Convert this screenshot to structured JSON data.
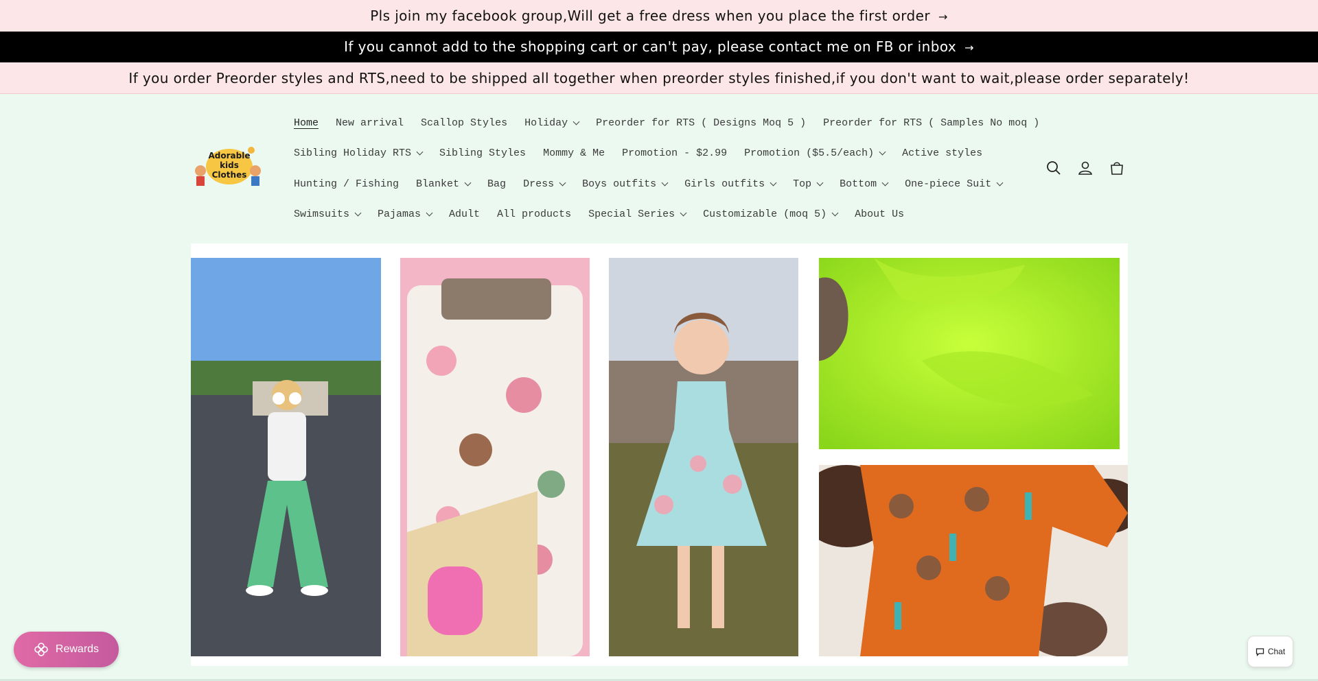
{
  "announcements": [
    {
      "text": "Pls join my facebook group,Will get a free dress when you place the first order",
      "arrow": "→"
    },
    {
      "text": "If you cannot add to the shopping cart or can't pay, please contact me on FB or inbox",
      "arrow": "→"
    },
    {
      "text": "If you order Preorder styles and RTS,need to be shipped all together when preorder styles finished,if you don't want to wait,please order separately!"
    }
  ],
  "logo": {
    "line1": "Adorable",
    "line2": "kids",
    "line3": "Clothes"
  },
  "nav": {
    "rows": [
      [
        {
          "label": "Home",
          "active": true
        },
        {
          "label": "New arrival"
        },
        {
          "label": "Scallop Styles"
        },
        {
          "label": "Holiday",
          "dropdown": true
        },
        {
          "label": "Preorder for RTS ( Designs Moq 5 )"
        },
        {
          "label": "Preorder for RTS ( Samples No moq )"
        }
      ],
      [
        {
          "label": "Sibling Holiday RTS",
          "dropdown": true
        },
        {
          "label": "Sibling Styles"
        },
        {
          "label": "Mommy & Me"
        },
        {
          "label": "Promotion - $2.99"
        },
        {
          "label": "Promotion ($5.5/each)",
          "dropdown": true
        },
        {
          "label": "Active styles"
        }
      ],
      [
        {
          "label": "Hunting / Fishing"
        },
        {
          "label": "Blanket",
          "dropdown": true
        },
        {
          "label": "Bag"
        },
        {
          "label": "Dress",
          "dropdown": true
        },
        {
          "label": "Boys outfits",
          "dropdown": true
        },
        {
          "label": "Girls outfits",
          "dropdown": true
        },
        {
          "label": "Top",
          "dropdown": true
        },
        {
          "label": "Bottom",
          "dropdown": true
        },
        {
          "label": "One-piece Suit",
          "dropdown": true
        }
      ],
      [
        {
          "label": "Swimsuits",
          "dropdown": true
        },
        {
          "label": "Pajamas",
          "dropdown": true
        },
        {
          "label": "Adult"
        },
        {
          "label": "All products"
        },
        {
          "label": "Special Series",
          "dropdown": true
        },
        {
          "label": "Customizable (moq 5)",
          "dropdown": true
        },
        {
          "label": "About Us"
        }
      ]
    ]
  },
  "header_icons": [
    "search-icon",
    "account-icon",
    "cart-icon"
  ],
  "rewards": {
    "label": "Rewards",
    "icon": "rewards-flower-icon"
  },
  "chat": {
    "label": "Chat",
    "icon": "chat-bubble-icon"
  },
  "colors": {
    "announcement_pink": "#fde6e7",
    "announcement_black": "#000000",
    "page_bg": "#ecf9f1",
    "rewards_pink": "#e06aa6"
  }
}
